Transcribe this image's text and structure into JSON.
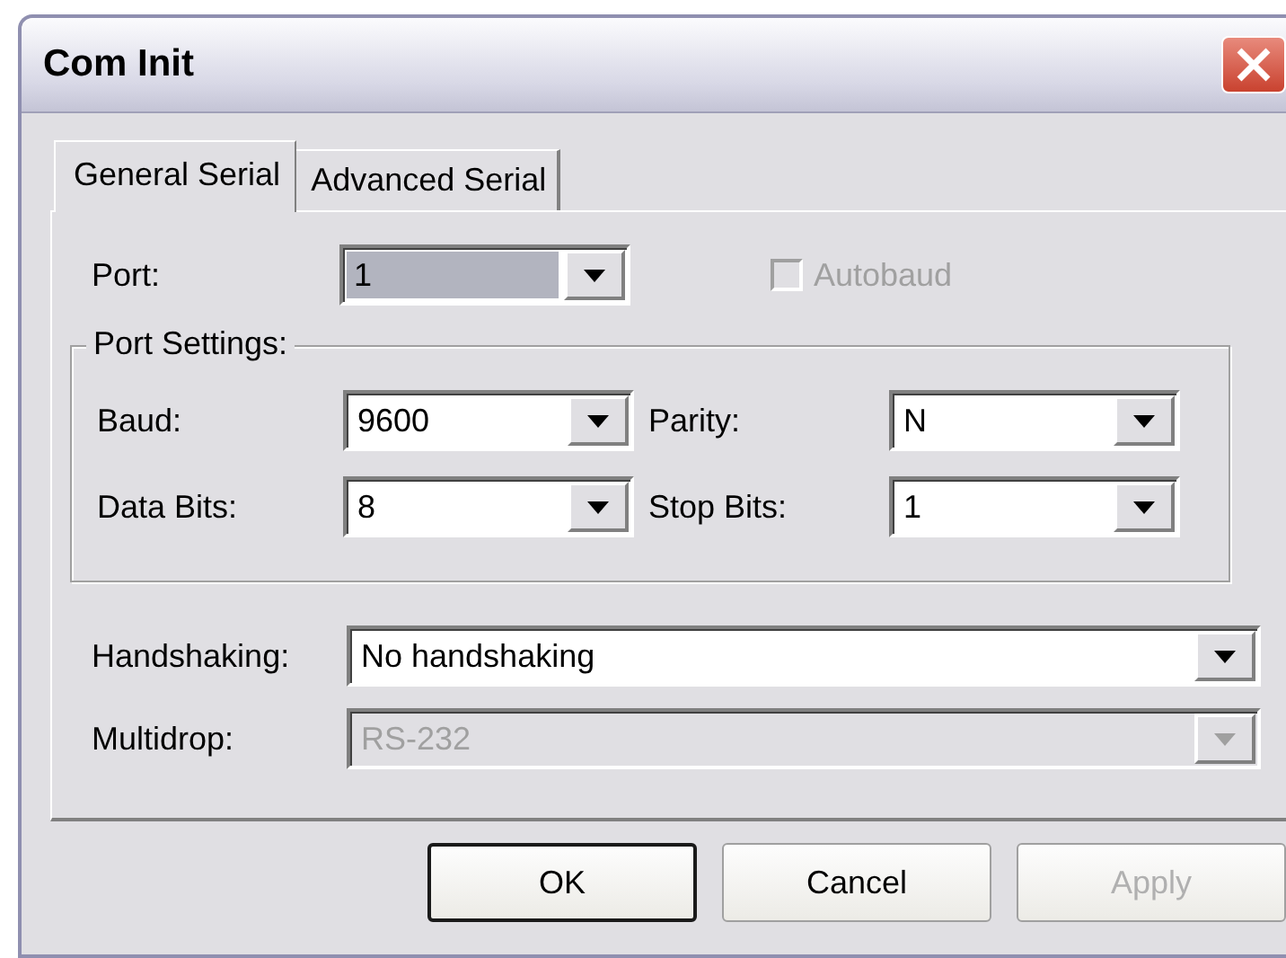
{
  "window": {
    "title": "Com Init"
  },
  "tabs": [
    {
      "label": "General Serial",
      "selected": true
    },
    {
      "label": "Advanced Serial",
      "selected": false
    }
  ],
  "port": {
    "label": "Port:",
    "value": "1",
    "highlighted": true,
    "disabled": false
  },
  "autobaud": {
    "label": "Autobaud",
    "checked": false,
    "disabled": true
  },
  "port_settings": {
    "title": "Port Settings:",
    "fields": [
      {
        "label": "Baud:",
        "value": "9600",
        "disabled": false
      },
      {
        "label": "Parity:",
        "value": "N",
        "disabled": false
      },
      {
        "label": "Data Bits:",
        "value": "8",
        "disabled": false
      },
      {
        "label": "Stop Bits:",
        "value": "1",
        "disabled": false
      }
    ]
  },
  "fields": [
    {
      "label": "Handshaking:",
      "value": "No handshaking",
      "disabled": false
    },
    {
      "label": "Multidrop:",
      "value": "RS-232",
      "disabled": true
    }
  ],
  "buttons": [
    {
      "label": "OK",
      "default": true,
      "disabled": false
    },
    {
      "label": "Cancel",
      "default": false,
      "disabled": false
    },
    {
      "label": "Apply",
      "default": false,
      "disabled": true
    }
  ]
}
